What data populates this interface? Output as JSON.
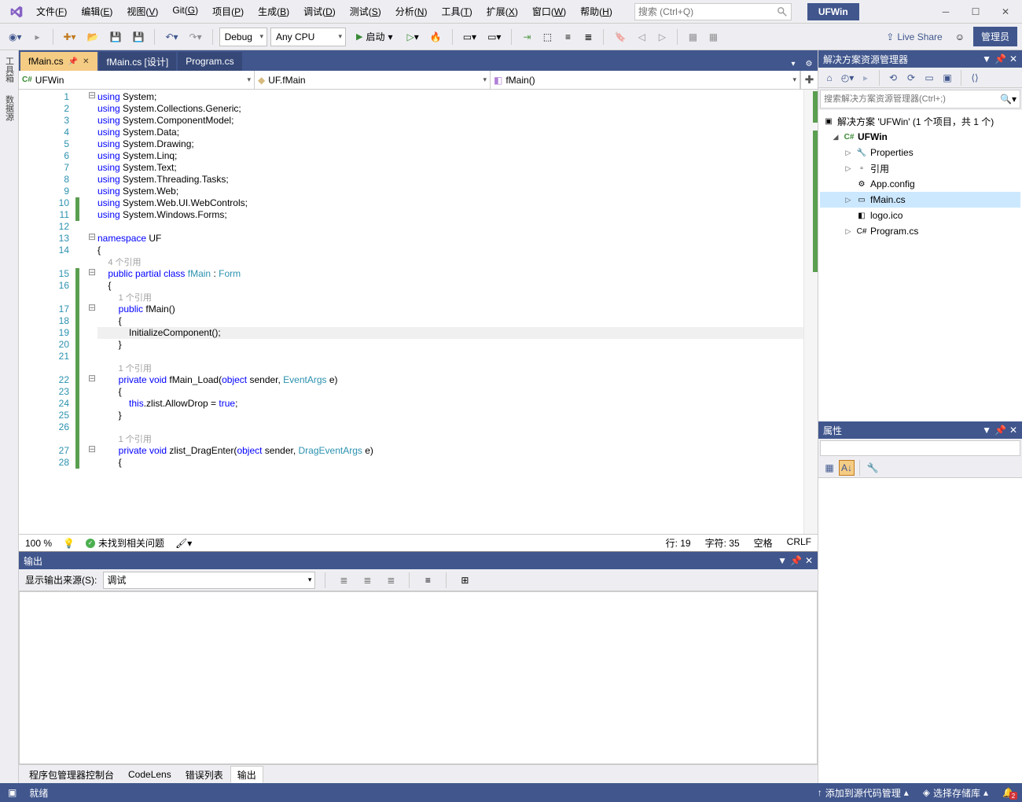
{
  "title_project": "UFWin",
  "menu": [
    "文件(F)",
    "编辑(E)",
    "视图(V)",
    "Git(G)",
    "项目(P)",
    "生成(B)",
    "调试(D)",
    "测试(S)",
    "分析(N)",
    "工具(T)",
    "扩展(X)",
    "窗口(W)",
    "帮助(H)"
  ],
  "search_placeholder": "搜索 (Ctrl+Q)",
  "admin_label": "管理员",
  "toolbar": {
    "config": "Debug",
    "platform": "Any CPU",
    "run_label": "启动",
    "liveshare": "Live Share"
  },
  "vertical_tabs": [
    "工具箱",
    "数据源"
  ],
  "doc_tabs": [
    {
      "label": "fMain.cs",
      "active": true,
      "closable": true
    },
    {
      "label": "fMain.cs [设计]",
      "active": false
    },
    {
      "label": "Program.cs",
      "active": false
    }
  ],
  "nav": {
    "scope": "UFWin",
    "class": "UF.fMain",
    "member": "fMain()"
  },
  "code": {
    "lines": [
      {
        "n": 1,
        "fold": "⊟",
        "html": "<span class='kw'>using</span> System;"
      },
      {
        "n": 2,
        "html": "<span class='kw'>using</span> System.Collections.Generic;"
      },
      {
        "n": 3,
        "html": "<span class='kw'>using</span> System.ComponentModel;"
      },
      {
        "n": 4,
        "html": "<span class='kw'>using</span> System.Data;"
      },
      {
        "n": 5,
        "html": "<span class='kw'>using</span> System.Drawing;"
      },
      {
        "n": 6,
        "html": "<span class='kw'>using</span> System.Linq;"
      },
      {
        "n": 7,
        "html": "<span class='kw'>using</span> System.Text;"
      },
      {
        "n": 8,
        "html": "<span class='kw'>using</span> System.Threading.Tasks;"
      },
      {
        "n": 9,
        "html": "<span class='kw'>using</span> System.Web;"
      },
      {
        "n": 10,
        "bar": true,
        "html": "<span class='kw'>using</span> System.Web.UI.WebControls;"
      },
      {
        "n": 11,
        "bar": true,
        "html": "<span class='kw'>using</span> System.Windows.Forms;"
      },
      {
        "n": 12,
        "html": ""
      },
      {
        "n": 13,
        "fold": "⊟",
        "html": "<span class='kw'>namespace</span> UF"
      },
      {
        "n": 14,
        "html": "{"
      },
      {
        "n": 0,
        "html": "    <span class='ref'>4 个引用</span>"
      },
      {
        "n": 15,
        "fold": "⊟",
        "bar": true,
        "html": "    <span class='kw'>public</span> <span class='kw'>partial</span> <span class='kw'>class</span> <span class='type'>fMain</span> : <span class='type'>Form</span>"
      },
      {
        "n": 16,
        "bar": true,
        "html": "    {"
      },
      {
        "n": 0,
        "bar": true,
        "html": "        <span class='ref'>1 个引用</span>"
      },
      {
        "n": 17,
        "fold": "⊟",
        "bar": true,
        "html": "        <span class='kw'>public</span> fMain()"
      },
      {
        "n": 18,
        "bar": true,
        "html": "        {"
      },
      {
        "n": 19,
        "bar": true,
        "hl": true,
        "html": "            InitializeComponent();"
      },
      {
        "n": 20,
        "bar": true,
        "html": "        }"
      },
      {
        "n": 21,
        "bar": true,
        "html": ""
      },
      {
        "n": 0,
        "bar": true,
        "html": "        <span class='ref'>1 个引用</span>"
      },
      {
        "n": 22,
        "fold": "⊟",
        "bar": true,
        "html": "        <span class='kw'>private</span> <span class='kw'>void</span> fMain_Load(<span class='kw'>object</span> sender, <span class='type'>EventArgs</span> e)"
      },
      {
        "n": 23,
        "bar": true,
        "html": "        {"
      },
      {
        "n": 24,
        "bar": true,
        "html": "            <span class='kw'>this</span>.zlist.AllowDrop = <span class='kw'>true</span>;"
      },
      {
        "n": 25,
        "bar": true,
        "html": "        }"
      },
      {
        "n": 26,
        "bar": true,
        "html": ""
      },
      {
        "n": 0,
        "bar": true,
        "html": "        <span class='ref'>1 个引用</span>"
      },
      {
        "n": 27,
        "fold": "⊟",
        "bar": true,
        "html": "        <span class='kw'>private</span> <span class='kw'>void</span> zlist_DragEnter(<span class='kw'>object</span> sender, <span class='type'>DragEventArgs</span> e)"
      },
      {
        "n": 28,
        "bar": true,
        "html": "        {"
      }
    ]
  },
  "editor_status": {
    "zoom": "100 %",
    "issues": "未找到相关问题",
    "line": "行: 19",
    "col": "字符: 35",
    "ins": "空格",
    "eol": "CRLF"
  },
  "output": {
    "title": "输出",
    "source_label": "显示输出来源(S):",
    "source_value": "调试"
  },
  "bottom_tabs": [
    "程序包管理器控制台",
    "CodeLens",
    "错误列表",
    "输出"
  ],
  "bottom_active": "输出",
  "solution_explorer": {
    "title": "解决方案资源管理器",
    "search_placeholder": "搜索解决方案资源管理器(Ctrl+;)",
    "root": "解决方案 'UFWin' (1 个项目，共 1 个)",
    "project": "UFWin",
    "nodes": [
      {
        "label": "Properties",
        "icon": "🔧",
        "exp": true
      },
      {
        "label": "引用",
        "icon": "▫",
        "exp": true
      },
      {
        "label": "App.config",
        "icon": "⚙"
      },
      {
        "label": "fMain.cs",
        "icon": "▭",
        "exp": true,
        "sel": true
      },
      {
        "label": "logo.ico",
        "icon": "◧"
      },
      {
        "label": "Program.cs",
        "icon": "C#",
        "exp": true
      }
    ]
  },
  "properties": {
    "title": "属性"
  },
  "statusbar": {
    "ready": "就绪",
    "source_control": "添加到源代码管理",
    "repo": "选择存储库",
    "notif_count": "2"
  }
}
